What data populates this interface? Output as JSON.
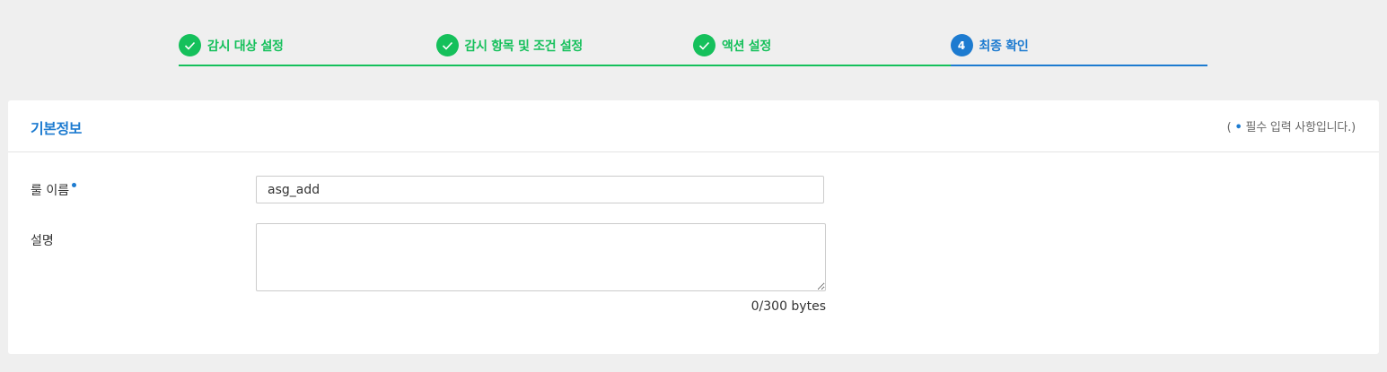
{
  "steps": [
    {
      "label": "감시 대상 설정",
      "status": "done",
      "icon": "check-icon"
    },
    {
      "label": "감시 항목 및 조건 설정",
      "status": "done",
      "icon": "check-icon"
    },
    {
      "label": "액션 설정",
      "status": "done",
      "icon": "check-icon"
    },
    {
      "number": "4",
      "label": "최종 확인",
      "status": "active"
    }
  ],
  "panel": {
    "title": "기본정보",
    "required_note_prefix": "( ",
    "required_note_dot": "•",
    "required_note_text": " 필수 입력 사항입니다.)"
  },
  "form": {
    "rule_name_label": "룰 이름",
    "rule_name_value": "asg_add",
    "description_label": "설명",
    "description_value": "",
    "byte_counter": "0/300 bytes"
  },
  "colors": {
    "done": "#15c05b",
    "active": "#1d7bd0",
    "background": "#efefef"
  }
}
